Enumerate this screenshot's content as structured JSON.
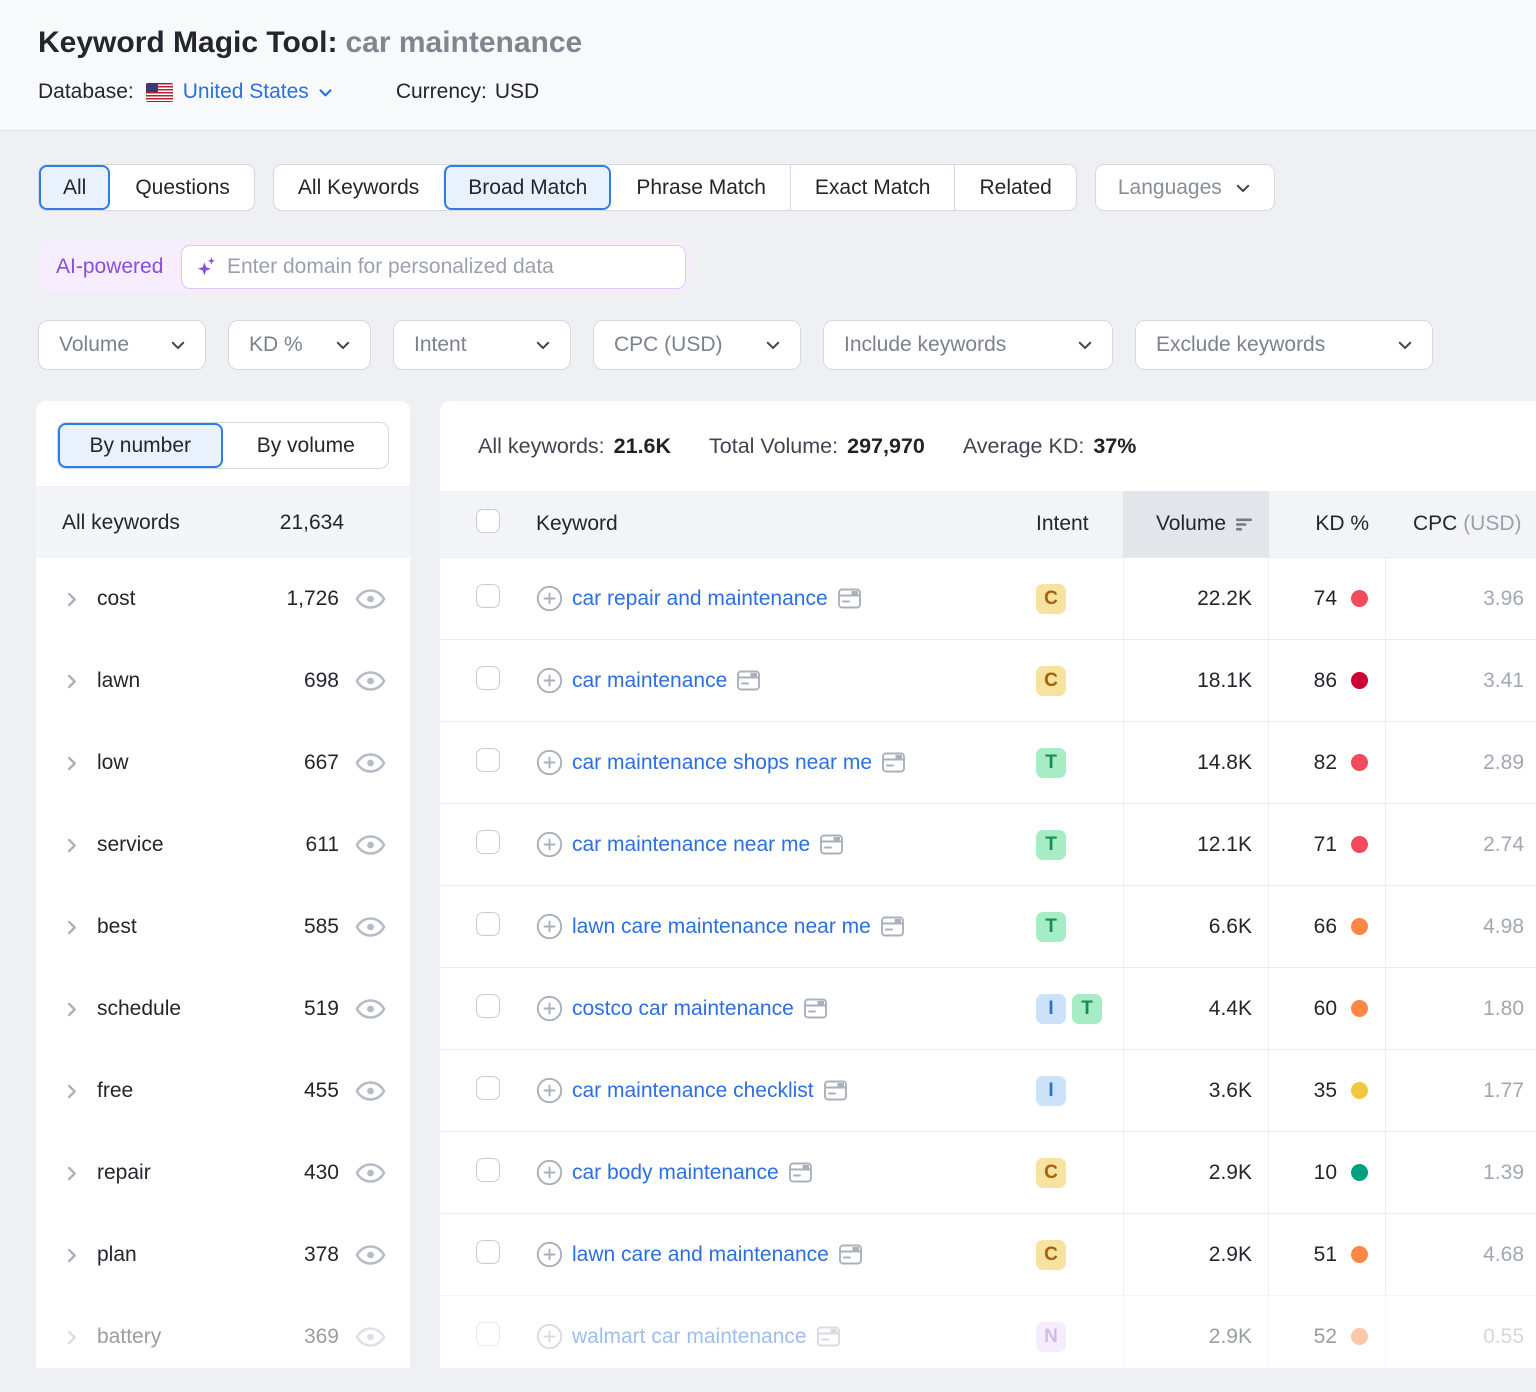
{
  "header": {
    "title": "Keyword Magic Tool:",
    "query": "car maintenance",
    "database_label": "Database:",
    "database_value": "United States",
    "currency_label": "Currency:",
    "currency_value": "USD"
  },
  "match_tabs": {
    "scope": [
      {
        "label": "All",
        "selected": true
      },
      {
        "label": "Questions",
        "selected": false
      }
    ],
    "match": [
      {
        "label": "All Keywords",
        "selected": false
      },
      {
        "label": "Broad Match",
        "selected": true
      },
      {
        "label": "Phrase Match",
        "selected": false
      },
      {
        "label": "Exact Match",
        "selected": false
      },
      {
        "label": "Related",
        "selected": false
      }
    ],
    "languages_label": "Languages"
  },
  "ai_bar": {
    "badge_label": "AI-powered",
    "input_value": "",
    "input_placeholder": "Enter domain for personalized data"
  },
  "filters": [
    {
      "label": "Volume"
    },
    {
      "label": "KD %"
    },
    {
      "label": "Intent"
    },
    {
      "label": "CPC (USD)"
    },
    {
      "label": "Include keywords"
    },
    {
      "label": "Exclude keywords"
    }
  ],
  "sidebar": {
    "view_toggle": [
      {
        "label": "By number",
        "selected": true
      },
      {
        "label": "By volume",
        "selected": false
      }
    ],
    "header_label": "All keywords",
    "header_count": "21,634",
    "groups": [
      {
        "label": "cost",
        "count": "1,726",
        "faded": false
      },
      {
        "label": "lawn",
        "count": "698",
        "faded": false
      },
      {
        "label": "low",
        "count": "667",
        "faded": false
      },
      {
        "label": "service",
        "count": "611",
        "faded": false
      },
      {
        "label": "best",
        "count": "585",
        "faded": false
      },
      {
        "label": "schedule",
        "count": "519",
        "faded": false
      },
      {
        "label": "free",
        "count": "455",
        "faded": false
      },
      {
        "label": "repair",
        "count": "430",
        "faded": false
      },
      {
        "label": "plan",
        "count": "378",
        "faded": false
      },
      {
        "label": "battery",
        "count": "369",
        "faded": true
      }
    ]
  },
  "table": {
    "stats": {
      "keywords_label": "All keywords:",
      "keywords_value": "21.6K",
      "volume_label": "Total Volume:",
      "volume_value": "297,970",
      "kd_label": "Average KD:",
      "kd_value": "37%"
    },
    "columns": {
      "keyword": "Keyword",
      "intent": "Intent",
      "volume": "Volume",
      "kd": "KD %",
      "cpc_main": "CPC ",
      "cpc_unit": "(USD)"
    },
    "rows": [
      {
        "keyword": "car repair and maintenance",
        "intents": [
          "C"
        ],
        "volume": "22.2K",
        "kd": "74",
        "kd_level": "red",
        "cpc": "3.96",
        "faded": false
      },
      {
        "keyword": "car maintenance",
        "intents": [
          "C"
        ],
        "volume": "18.1K",
        "kd": "86",
        "kd_level": "dark_red",
        "cpc": "3.41",
        "faded": false
      },
      {
        "keyword": "car maintenance shops near me",
        "intents": [
          "T"
        ],
        "volume": "14.8K",
        "kd": "82",
        "kd_level": "red",
        "cpc": "2.89",
        "faded": false
      },
      {
        "keyword": "car maintenance near me",
        "intents": [
          "T"
        ],
        "volume": "12.1K",
        "kd": "71",
        "kd_level": "red",
        "cpc": "2.74",
        "faded": false
      },
      {
        "keyword": "lawn care maintenance near me",
        "intents": [
          "T"
        ],
        "volume": "6.6K",
        "kd": "66",
        "kd_level": "orange",
        "cpc": "4.98",
        "faded": false
      },
      {
        "keyword": "costco car maintenance",
        "intents": [
          "I",
          "T"
        ],
        "volume": "4.4K",
        "kd": "60",
        "kd_level": "orange",
        "cpc": "1.80",
        "faded": false
      },
      {
        "keyword": "car maintenance checklist",
        "intents": [
          "I"
        ],
        "volume": "3.6K",
        "kd": "35",
        "kd_level": "yellow",
        "cpc": "1.77",
        "faded": false
      },
      {
        "keyword": "car body maintenance",
        "intents": [
          "C"
        ],
        "volume": "2.9K",
        "kd": "10",
        "kd_level": "green",
        "cpc": "1.39",
        "faded": false
      },
      {
        "keyword": "lawn care and maintenance",
        "intents": [
          "C"
        ],
        "volume": "2.9K",
        "kd": "51",
        "kd_level": "orange",
        "cpc": "4.68",
        "faded": false
      },
      {
        "keyword": "walmart car maintenance",
        "intents": [
          "N"
        ],
        "volume": "2.9K",
        "kd": "52",
        "kd_level": "orange",
        "cpc": "0.55",
        "faded": true
      }
    ]
  },
  "colors": {
    "accent_blue": "#2f7ce8",
    "link_blue": "#2b6fe0",
    "ai_purple": "#8a4be0",
    "intent": {
      "C": {
        "bg": "#f8e2a0",
        "fg": "#a2610a"
      },
      "I": {
        "bg": "#cbe2f8",
        "fg": "#2d71c9"
      },
      "T": {
        "bg": "#a6ecc5",
        "fg": "#178d5b"
      },
      "N": {
        "bg": "#ead9fa",
        "fg": "#9a68d8"
      }
    },
    "kd_dots": {
      "green": "#009f81",
      "yellow": "#f3c73c",
      "orange": "#ff8743",
      "red": "#f44a5e",
      "dark_red": "#ce0030"
    }
  },
  "icons": {
    "flag": "us-flag-icon",
    "dropdown": "chevron-down-icon",
    "ai": "sparkle-icon",
    "group_expand": "chevron-right-icon",
    "group_hide": "eye-icon",
    "add_keyword": "plus-circle-icon",
    "serp": "serp-features-icon",
    "sort": "sort-descending-icon"
  }
}
